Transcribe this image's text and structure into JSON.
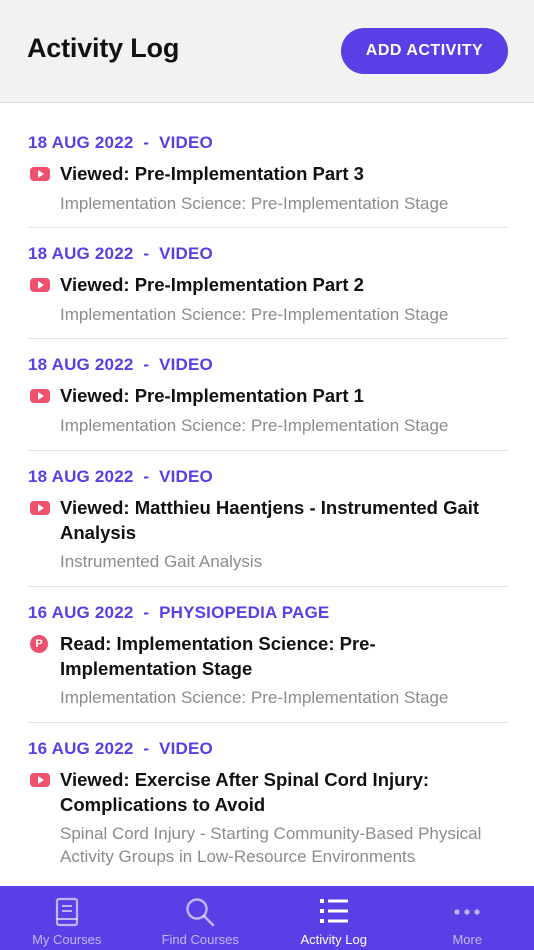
{
  "header": {
    "title": "Activity Log",
    "add_button_label": "ADD ACTIVITY"
  },
  "activities": [
    {
      "meta": "18 AUG 2022  -  VIDEO",
      "icon": "video-icon",
      "title": "Viewed: Pre-Implementation Part 3",
      "course": "Implementation Science: Pre-Implementation Stage"
    },
    {
      "meta": "18 AUG 2022  -  VIDEO",
      "icon": "video-icon",
      "title": "Viewed: Pre-Implementation Part 2",
      "course": "Implementation Science: Pre-Implementation Stage"
    },
    {
      "meta": "18 AUG 2022  -  VIDEO",
      "icon": "video-icon",
      "title": "Viewed: Pre-Implementation Part 1",
      "course": "Implementation Science: Pre-Implementation Stage"
    },
    {
      "meta": "18 AUG 2022  -  VIDEO",
      "icon": "video-icon",
      "title": "Viewed: Matthieu Haentjens - Instrumented Gait Analysis",
      "course": "Instrumented Gait Analysis"
    },
    {
      "meta": "16 AUG 2022  -  PHYSIOPEDIA PAGE",
      "icon": "physiopedia-icon",
      "icon_letter": "P",
      "title": "Read: Implementation Science: Pre-Implementation Stage",
      "course": "Implementation Science: Pre-Implementation Stage"
    },
    {
      "meta": "16 AUG 2022  -  VIDEO",
      "icon": "video-icon",
      "title": "Viewed: Exercise After Spinal Cord Injury: Complications to Avoid",
      "course": "Spinal Cord Injury - Starting Community-Based Physical Activity Groups in Low-Resource Environments"
    }
  ],
  "tabbar": {
    "tabs": [
      {
        "label": "My Courses",
        "icon": "book-icon",
        "active": false
      },
      {
        "label": "Find Courses",
        "icon": "search-icon",
        "active": false
      },
      {
        "label": "Activity Log",
        "icon": "list-icon",
        "active": true
      },
      {
        "label": "More",
        "icon": "more-dots-icon",
        "active": false
      }
    ]
  },
  "colors": {
    "accent": "#5b3ee6",
    "icon_red": "#ef5070",
    "header_bg": "#f2f2f2",
    "muted_text": "#8c8c8c"
  }
}
